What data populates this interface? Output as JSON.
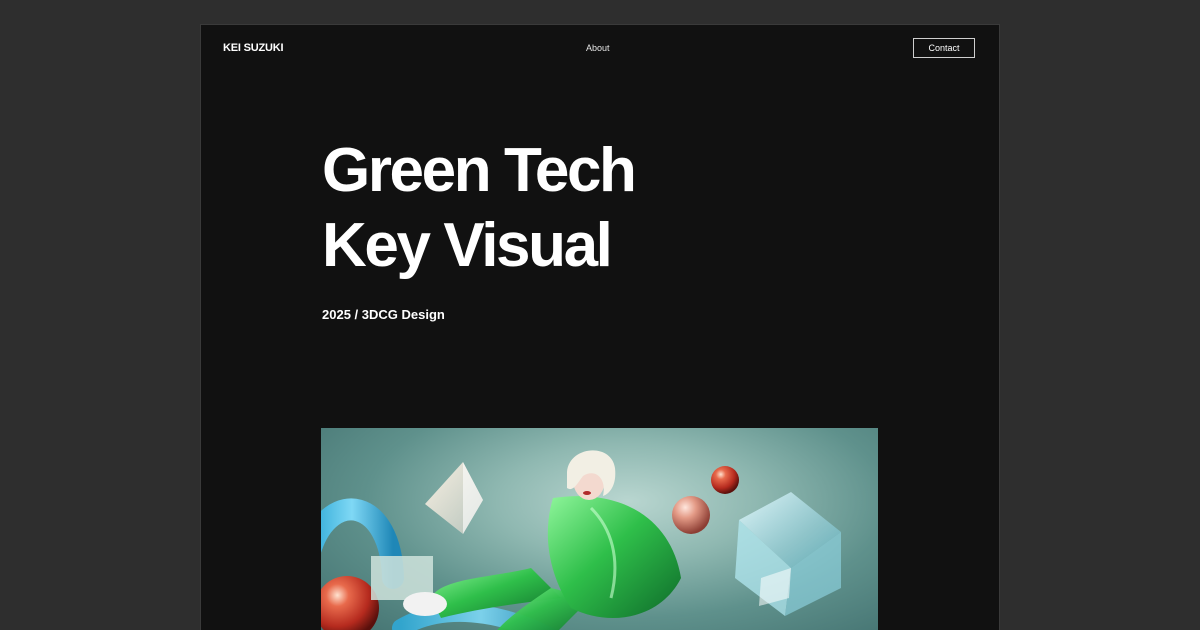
{
  "header": {
    "logo": "KEI SUZUKI",
    "nav": {
      "about": "About"
    },
    "contact": "Contact"
  },
  "hero": {
    "title_line1": "Green Tech",
    "title_line2": "Key Visual",
    "meta": "2025 / 3DCG Design"
  },
  "colors": {
    "page_bg": "#2e2e2e",
    "window_bg": "#111111",
    "text": "#ffffff",
    "visual_teal": "#5f918c",
    "jacket_green": "#2fbf4a",
    "sphere_red": "#c8382a"
  }
}
